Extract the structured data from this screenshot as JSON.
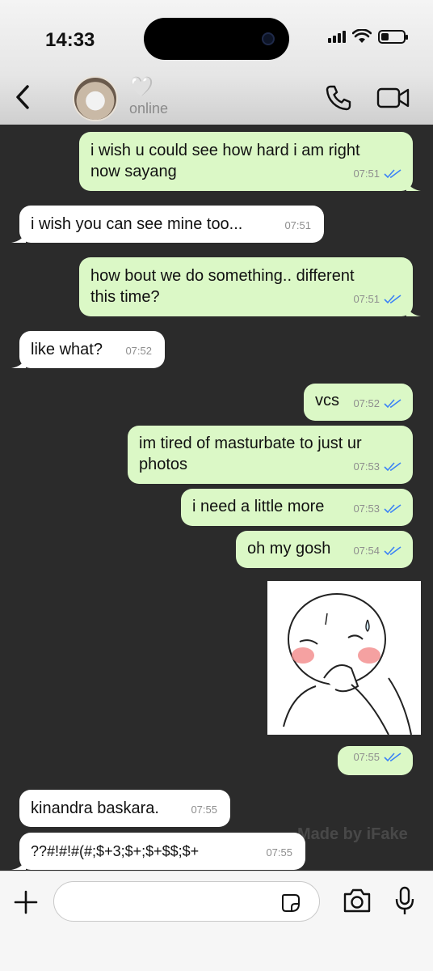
{
  "status_bar": {
    "time": "14:33"
  },
  "header": {
    "contact_name": "🤍",
    "presence": "online"
  },
  "messages": [
    {
      "dir": "out",
      "lines": [
        "i wish u could see how hard i am right",
        "now sayang"
      ],
      "time": "07:51"
    },
    {
      "dir": "in",
      "lines": [
        "i wish you can see mine too..."
      ],
      "time": "07:51"
    },
    {
      "dir": "out",
      "lines": [
        "how bout we do something.. different",
        "this time?"
      ],
      "time": "07:51"
    },
    {
      "dir": "in",
      "lines": [
        "like what?"
      ],
      "time": "07:52"
    },
    {
      "dir": "out",
      "lines": [
        "vcs"
      ],
      "time": "07:52"
    },
    {
      "dir": "out",
      "lines": [
        "im tired of masturbate to just ur",
        "photos"
      ],
      "time": "07:53"
    },
    {
      "dir": "out",
      "lines": [
        "i need a little more"
      ],
      "time": "07:53"
    },
    {
      "dir": "out",
      "lines": [
        "oh my gosh"
      ],
      "time": "07:54"
    },
    {
      "dir": "out",
      "lines": [],
      "time": "07:55"
    },
    {
      "dir": "in",
      "lines": [
        "kinandra baskara."
      ],
      "time": "07:55"
    },
    {
      "dir": "in",
      "lines": [
        "??#!#!#(#;$+3;$+;$+$$;$+"
      ],
      "time": "07:55"
    }
  ],
  "watermark": "Made by iFake",
  "composer": {
    "value": "",
    "placeholder": ""
  },
  "colors": {
    "outgoing_bubble": "#dbf8c6",
    "incoming_bubble": "#ffffff",
    "chat_background": "#2b2b2b",
    "read_ticks": "#3b82f6"
  },
  "icons": [
    "back-chevron-icon",
    "phone-icon",
    "video-camera-icon",
    "plus-icon",
    "sticker-icon",
    "camera-icon",
    "microphone-icon"
  ]
}
